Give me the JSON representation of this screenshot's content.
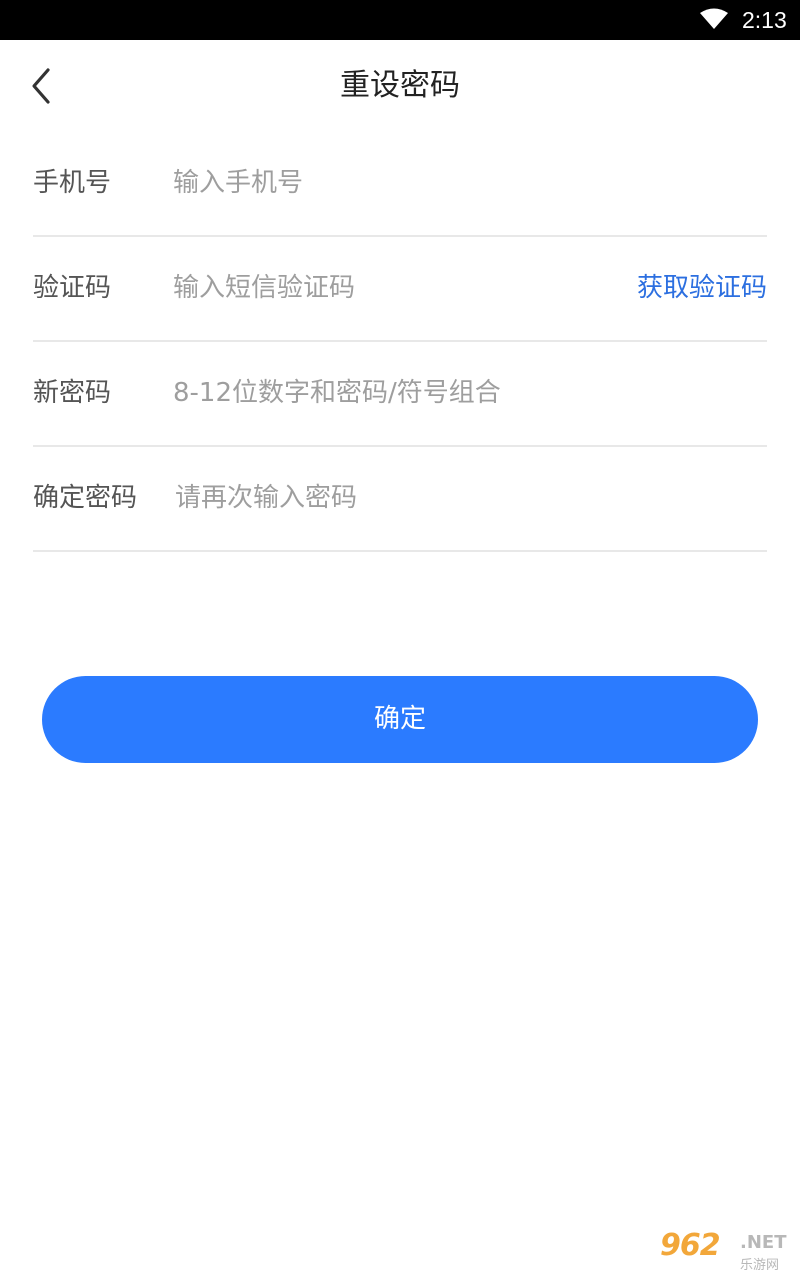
{
  "status_bar": {
    "time": "2:13",
    "icons": [
      "wifi-icon"
    ]
  },
  "header": {
    "title": "重设密码",
    "back_icon": "chevron-left-icon"
  },
  "form": {
    "phone": {
      "label": "手机号",
      "placeholder": "输入手机号",
      "value": ""
    },
    "code": {
      "label": "验证码",
      "placeholder": "输入短信验证码",
      "value": "",
      "action": "获取验证码"
    },
    "new_password": {
      "label": "新密码",
      "placeholder": "8-12位数字和密码/符号组合",
      "value": ""
    },
    "confirm_password": {
      "label": "确定密码",
      "placeholder": "请再次输入密码",
      "value": ""
    }
  },
  "submit": {
    "label": "确定"
  },
  "watermark": {
    "number": "962",
    "suffix": ".NET",
    "subtitle": "乐游网"
  },
  "colors": {
    "accent": "#2b7bff",
    "link": "#2c6fe0",
    "divider": "#e8e8e8",
    "status_bar": "#000000"
  }
}
